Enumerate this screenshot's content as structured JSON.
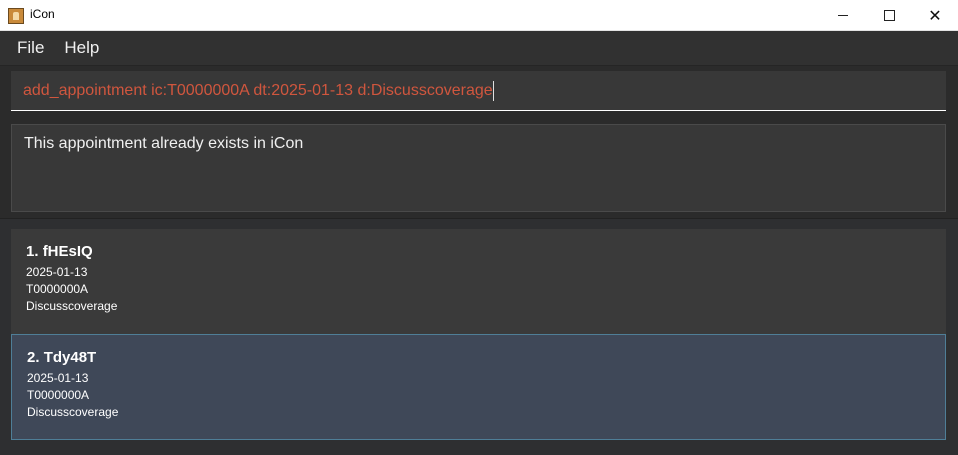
{
  "window": {
    "title": "iCon",
    "icon": "app-icon"
  },
  "menu": {
    "items": [
      "File",
      "Help"
    ]
  },
  "command": {
    "value": "add_appointment ic:T0000000A dt:2025-01-13 d:Discusscoverage",
    "text_color": "#d0563e"
  },
  "result": {
    "message": "This appointment already exists in iCon"
  },
  "appointments": [
    {
      "index": "1.",
      "name": "fHEsIQ",
      "date": "2025-01-13",
      "ic": "T0000000A",
      "description": "Discusscoverage",
      "selected": false
    },
    {
      "index": "2.",
      "name": "Tdy48T",
      "date": "2025-01-13",
      "ic": "T0000000A",
      "description": "Discusscoverage",
      "selected": true
    }
  ],
  "colors": {
    "background": "#2e2f31",
    "selected_card": "#3f4858",
    "selected_border": "#4f7e97"
  }
}
